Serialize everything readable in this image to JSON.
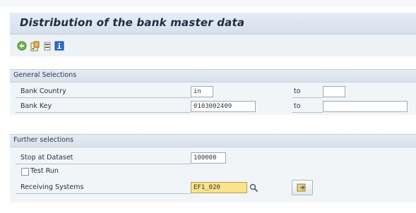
{
  "header": {
    "title": "Distribution of the bank master data"
  },
  "toolbar": {
    "icons": [
      "execute-icon",
      "get-variant-icon",
      "delete-selection-icon",
      "information-icon"
    ]
  },
  "general_selections": {
    "title": "General Selections",
    "bank_country": {
      "label": "Bank Country",
      "value": "in",
      "to_label": "to",
      "to_value": ""
    },
    "bank_key": {
      "label": "Bank Key",
      "value": "0103002409",
      "to_label": "to",
      "to_value": ""
    }
  },
  "further_selections": {
    "title": "Further selections",
    "stop_at_dataset": {
      "label": "Stop at Dataset",
      "value": "100000"
    },
    "test_run": {
      "label": "Test Run",
      "checked": false
    },
    "receiving_systems": {
      "label": "Receiving Systems",
      "value": "EF1_020"
    }
  },
  "colors": {
    "title_bar": "#d5e0ec",
    "group_bg": "#f2f5f8",
    "highlight_field": "#fbe38a",
    "title_text": "#1d2c3e"
  }
}
